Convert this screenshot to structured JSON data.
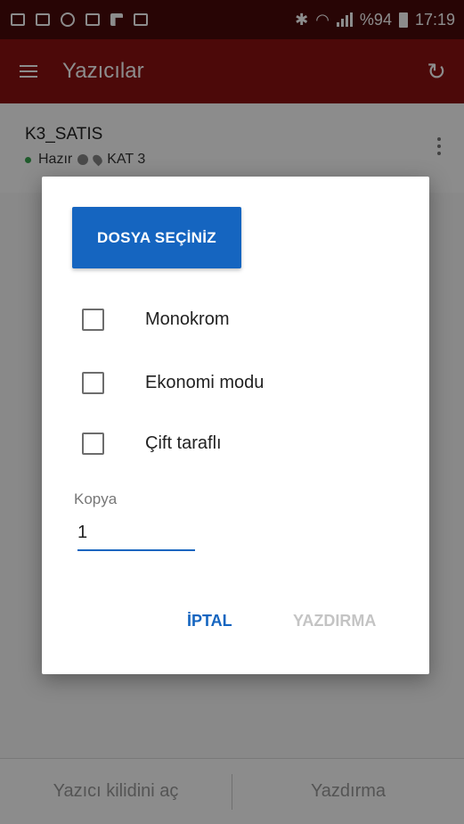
{
  "status_bar": {
    "battery": "%94",
    "time": "17:19",
    "left_icons": [
      "gallery-icon",
      "message-icon",
      "vpn-icon",
      "mail-icon",
      "flipboard-icon",
      "briefcase-icon"
    ],
    "right_icons": [
      "bluetooth-icon",
      "wifi-icon",
      "signal-icon",
      "battery-icon"
    ]
  },
  "app_bar": {
    "title": "Yazıcılar",
    "menu_icon": "hamburger-icon",
    "refresh_icon": "refresh-icon",
    "color": "#8a1212"
  },
  "printer": {
    "name": "K3_SATIS",
    "status": "Hazır",
    "location": "KAT 3",
    "status_color": "#3aa650"
  },
  "dialog": {
    "choose_file_label": "DOSYA SEÇİNİZ",
    "options": [
      {
        "label": "Monokrom",
        "checked": false
      },
      {
        "label": "Ekonomi modu",
        "checked": false
      },
      {
        "label": "Çift taraflı",
        "checked": false
      }
    ],
    "copies_label": "Kopya",
    "copies_value": "1",
    "cancel_label": "İPTAL",
    "print_label": "YAZDIRMA",
    "accent": "#1565c0"
  },
  "bottom_bar": {
    "unlock_label": "Yazıcı kilidini aç",
    "print_label": "Yazdırma"
  }
}
